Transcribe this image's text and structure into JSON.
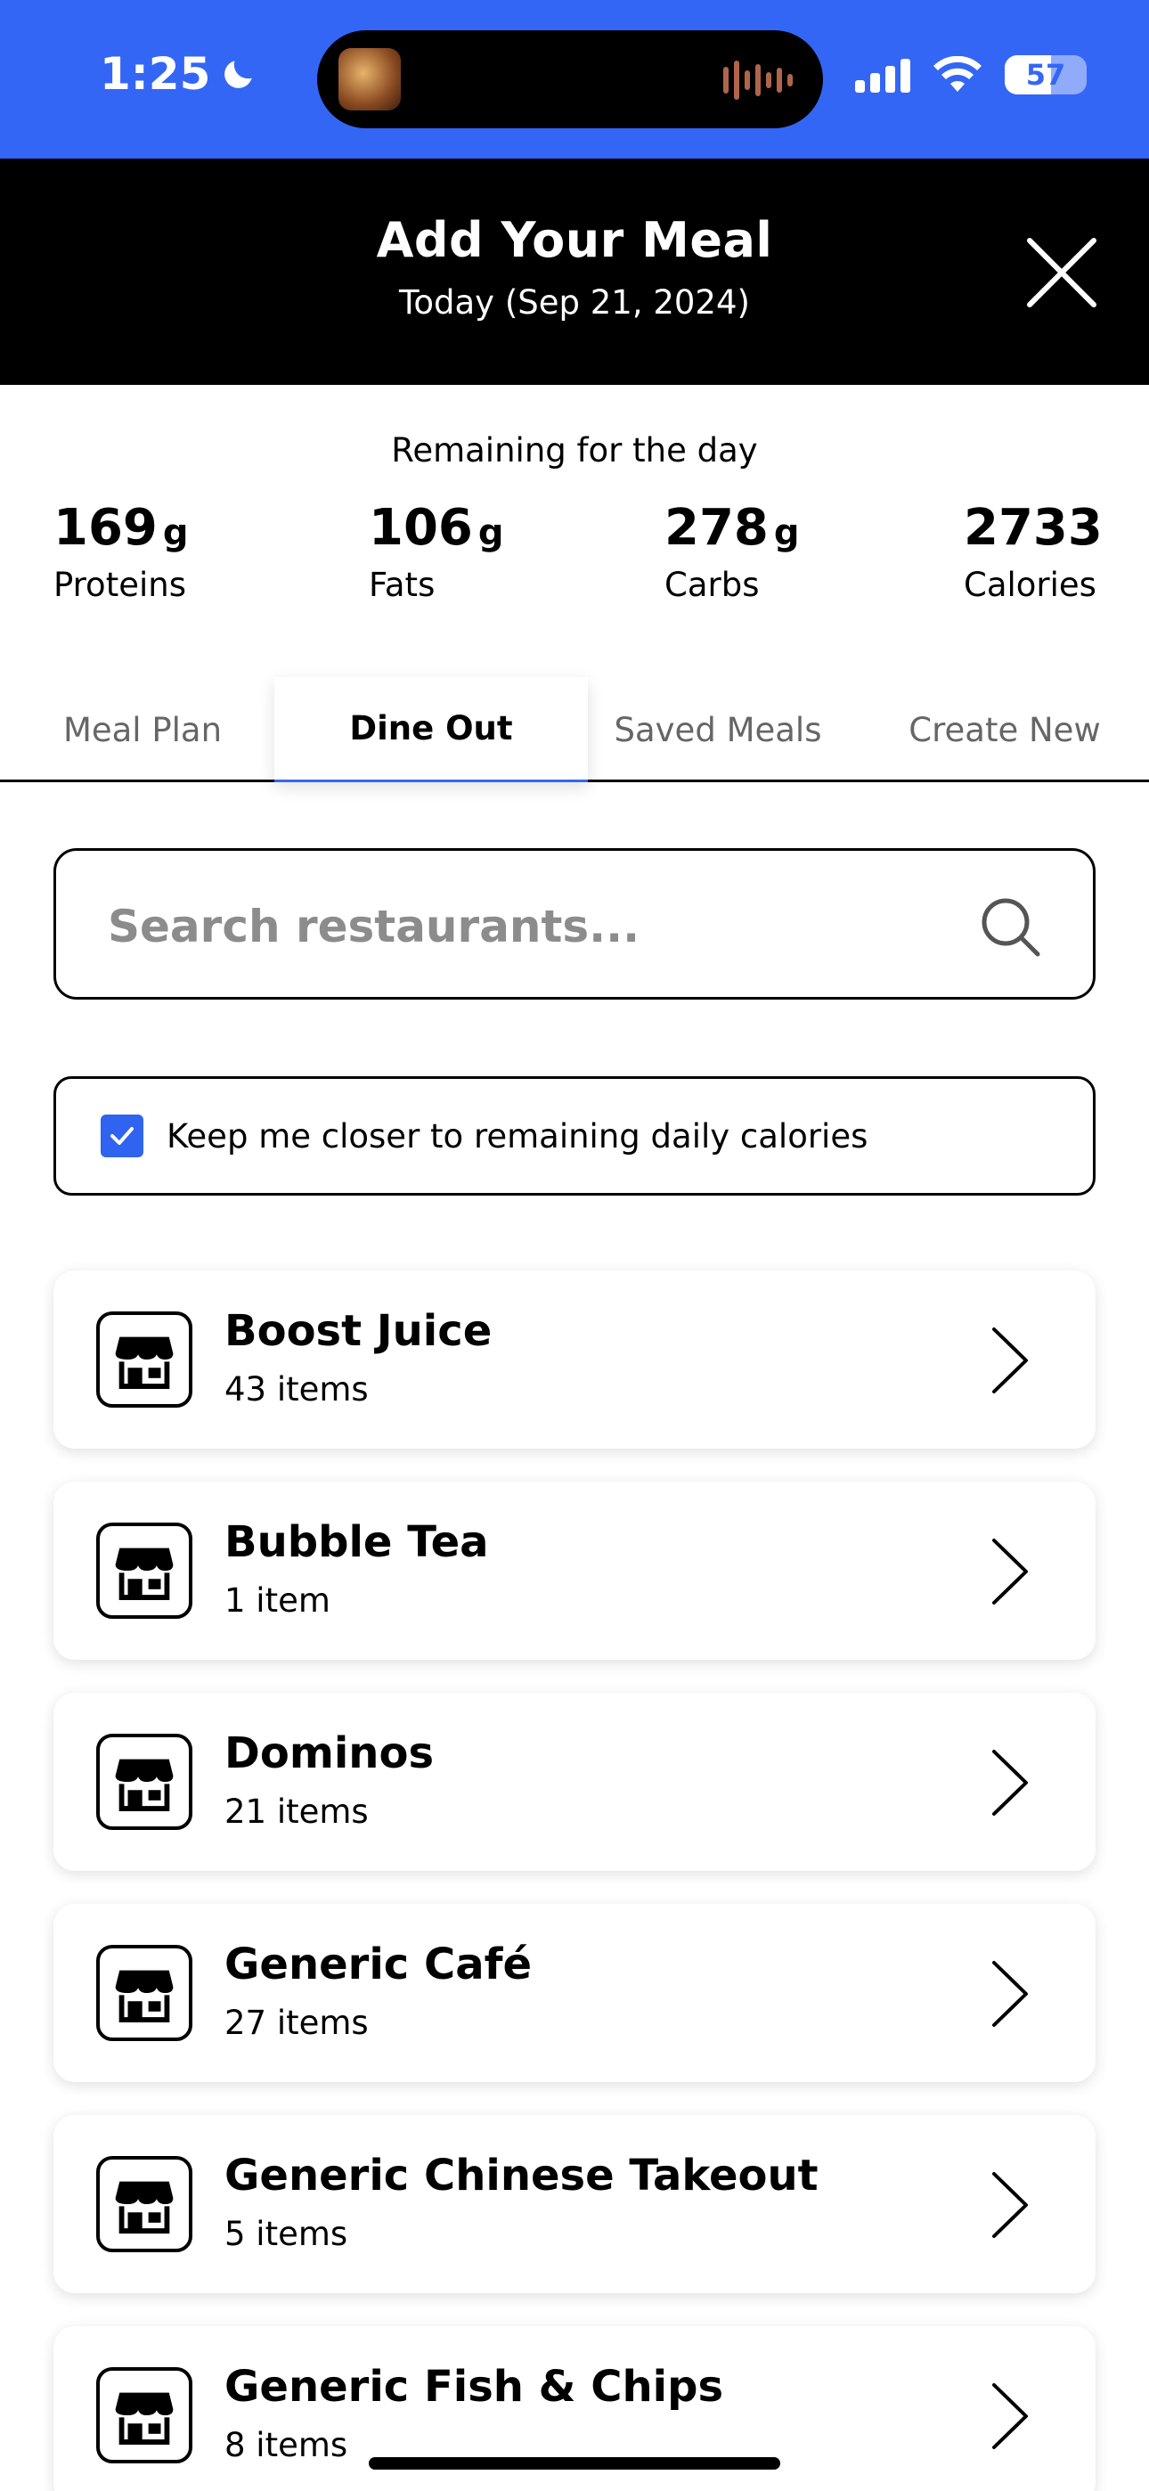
{
  "status_bar": {
    "time": "1:25",
    "battery": "57",
    "battery_level": 0.57,
    "icons": [
      "moon-icon",
      "signal-icon",
      "wifi-icon",
      "battery-icon"
    ]
  },
  "header": {
    "title": "Add Your Meal",
    "subtitle": "Today (Sep 21, 2024)",
    "close_icon": "close-icon"
  },
  "remaining": {
    "title": "Remaining for the day",
    "macros": [
      {
        "value": "169",
        "unit": "g",
        "label": "Proteins"
      },
      {
        "value": "106",
        "unit": "g",
        "label": "Fats"
      },
      {
        "value": "278",
        "unit": "g",
        "label": "Carbs"
      },
      {
        "value": "2733",
        "unit": "",
        "label": "Calories"
      }
    ]
  },
  "tabs": [
    {
      "label": "Meal Plan",
      "active": false
    },
    {
      "label": "Dine Out",
      "active": true
    },
    {
      "label": "Saved Meals",
      "active": false
    },
    {
      "label": "Create New",
      "active": false
    }
  ],
  "search": {
    "placeholder": "Search restaurants...",
    "value": "",
    "icon": "search-icon"
  },
  "keep_closer": {
    "label": "Keep me closer to remaining daily calories",
    "checked": true
  },
  "restaurants": [
    {
      "name": "Boost Juice",
      "count": "43 items"
    },
    {
      "name": "Bubble Tea",
      "count": "1 item"
    },
    {
      "name": "Dominos",
      "count": "21 items"
    },
    {
      "name": "Generic Café",
      "count": "27 items"
    },
    {
      "name": "Generic Chinese Takeout",
      "count": "5 items"
    },
    {
      "name": "Generic Fish & Chips",
      "count": "8 items"
    }
  ],
  "colors": {
    "status_bar": "#3466f6",
    "header_bg": "#000000",
    "accent": "#2f63f0"
  }
}
